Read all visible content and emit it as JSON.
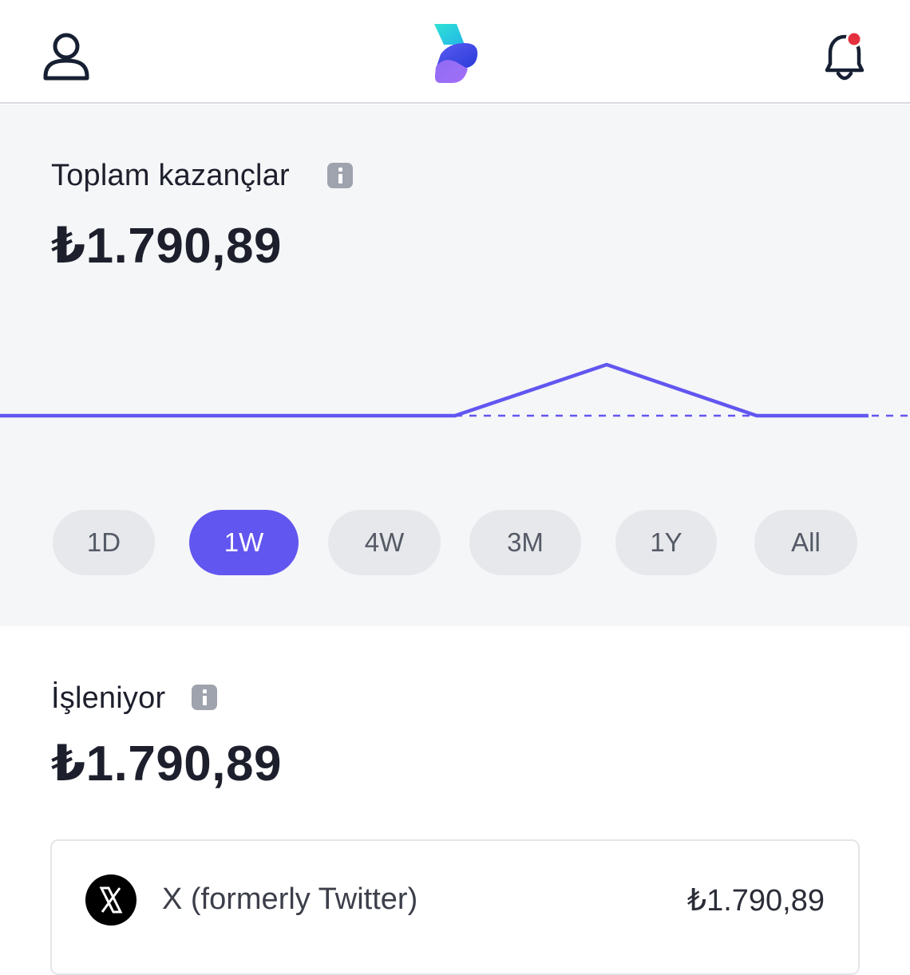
{
  "header": {
    "profile_icon": "user-icon",
    "logo": "app-logo",
    "notification_icon": "bell-icon",
    "notification_dot_color": "#e5303f"
  },
  "earnings": {
    "title": "Toplam kazançlar",
    "amount": "₺1.790,89",
    "info_icon": "info-icon"
  },
  "chart_data": {
    "type": "line",
    "color": "#6256f0",
    "x": [
      0,
      1,
      2,
      3,
      4,
      5,
      6,
      7
    ],
    "y": [
      0,
      0,
      0,
      0,
      1,
      0,
      0,
      null
    ],
    "baseline": "dashed",
    "grid": false,
    "title": "",
    "xlabel": "",
    "ylabel": ""
  },
  "ranges": {
    "options": [
      "1D",
      "1W",
      "4W",
      "3M",
      "1Y",
      "All"
    ],
    "selected": "1W"
  },
  "processing": {
    "title": "İşleniyor",
    "amount": "₺1.790,89",
    "info_icon": "info-icon"
  },
  "sources": [
    {
      "icon": "x-logo-icon",
      "name": "X (formerly Twitter)",
      "amount": "₺1.790,89"
    }
  ],
  "colors": {
    "accent": "#6256f0",
    "surface": "#f5f6f8",
    "chip": "#e6e8eb"
  }
}
